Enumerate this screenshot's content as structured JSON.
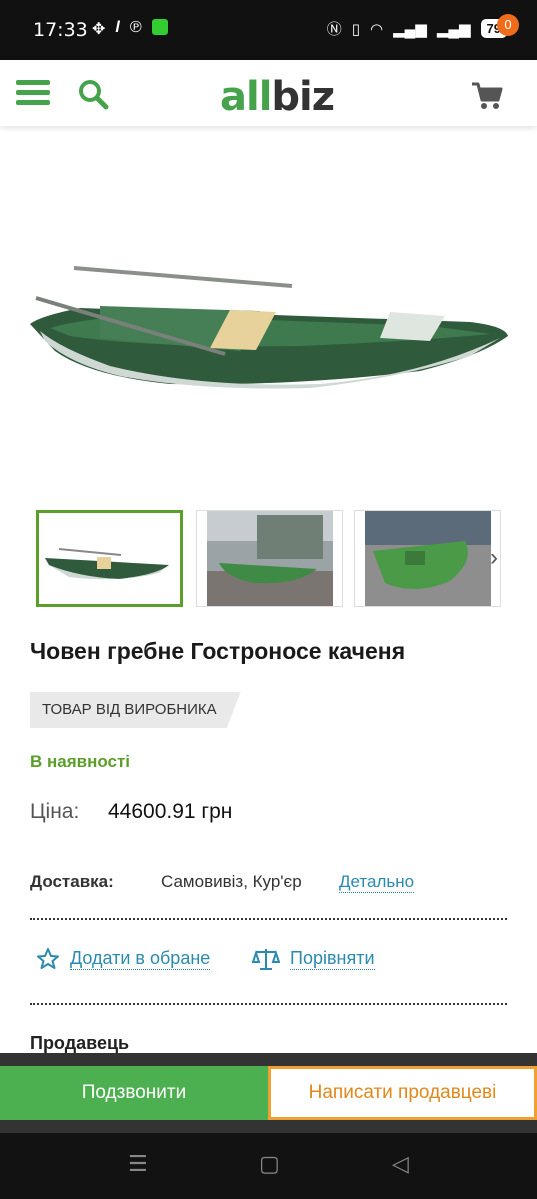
{
  "status": {
    "time": "17:33",
    "left_icons": [
      "fan-icon",
      "l-icon",
      "pinterest-icon",
      "app-icon"
    ],
    "right_icons": [
      "nfc-icon",
      "vibrate-icon",
      "wifi-icon",
      "signal-icon",
      "signal-4g-icon"
    ],
    "battery": "79"
  },
  "header": {
    "logo_part1": "all",
    "logo_part2": "biz",
    "cart_count": "0",
    "accent": "#47a34b"
  },
  "product": {
    "title": "Човен гребне Гостроносе каченя",
    "badge": "ТОВАР ВІД ВИРОБНИКА",
    "stock": "В наявності",
    "price_label": "Ціна:",
    "price_value": "44600.91 грн",
    "delivery_label": "Доставка:",
    "delivery_options": "Самовивіз,  Кур'єр",
    "delivery_link": "Детально",
    "add_favorite": "Додати в обране",
    "compare": "Порівняти",
    "seller_label": "Продавець"
  },
  "buttons": {
    "call": "Подзвонити",
    "write": "Написати продавцеві"
  }
}
